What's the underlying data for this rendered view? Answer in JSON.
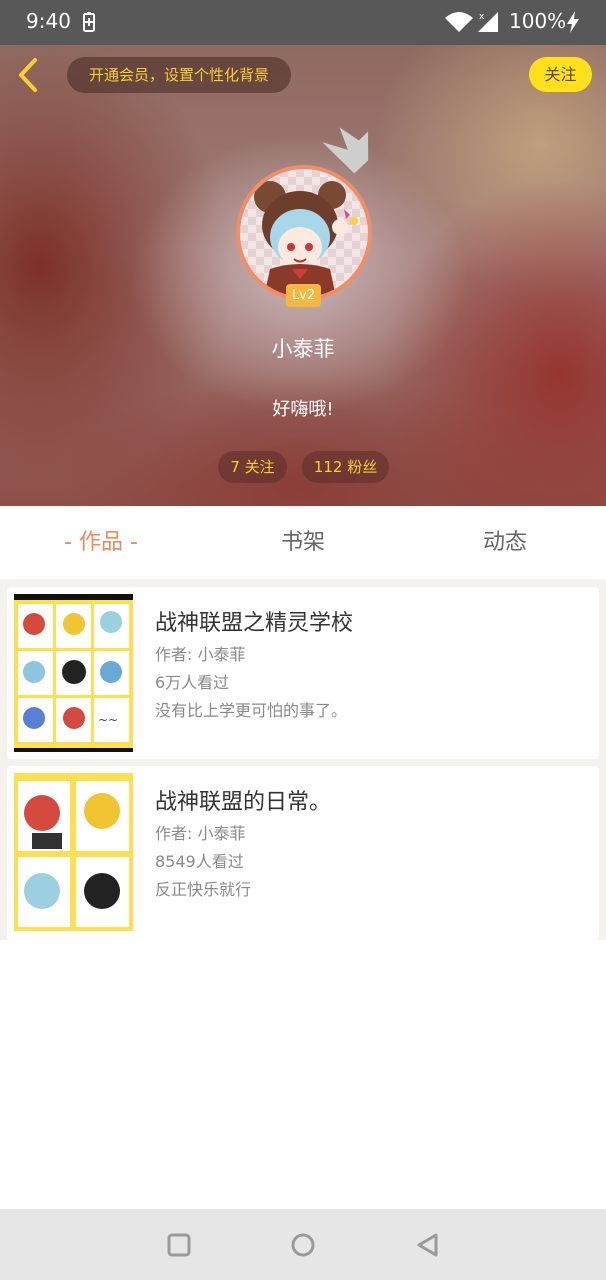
{
  "status_bar": {
    "time": "9:40",
    "battery": "100%",
    "icons": [
      "battery-saver-icon",
      "wifi-icon",
      "signal-icon",
      "charging-icon"
    ]
  },
  "header": {
    "vip_banner": "开通会员，设置个性化背景",
    "follow_label": "关注",
    "level": "Lv2",
    "username": "小泰菲",
    "bio": "好嗨哦!",
    "stats": {
      "following": "7 关注",
      "fans": "112 粉丝"
    },
    "accent_color": "#f5cf33",
    "follow_button_color": "#ffe01a"
  },
  "tabs": [
    {
      "label": "- 作品 -",
      "active": true
    },
    {
      "label": "书架",
      "active": false
    },
    {
      "label": "动态",
      "active": false
    }
  ],
  "active_tab_color": "#ef8a5c",
  "works": [
    {
      "title": "战神联盟之精灵学校",
      "author": "作者: 小泰菲",
      "views": "6万人看过",
      "description": "没有比上学更可怕的事了。"
    },
    {
      "title": "战神联盟的日常。",
      "author": "作者: 小泰菲",
      "views": "8549人看过",
      "description": "反正快乐就行"
    }
  ],
  "nav": {
    "icons": [
      "recents-icon",
      "home-icon",
      "back-triangle-icon"
    ]
  }
}
